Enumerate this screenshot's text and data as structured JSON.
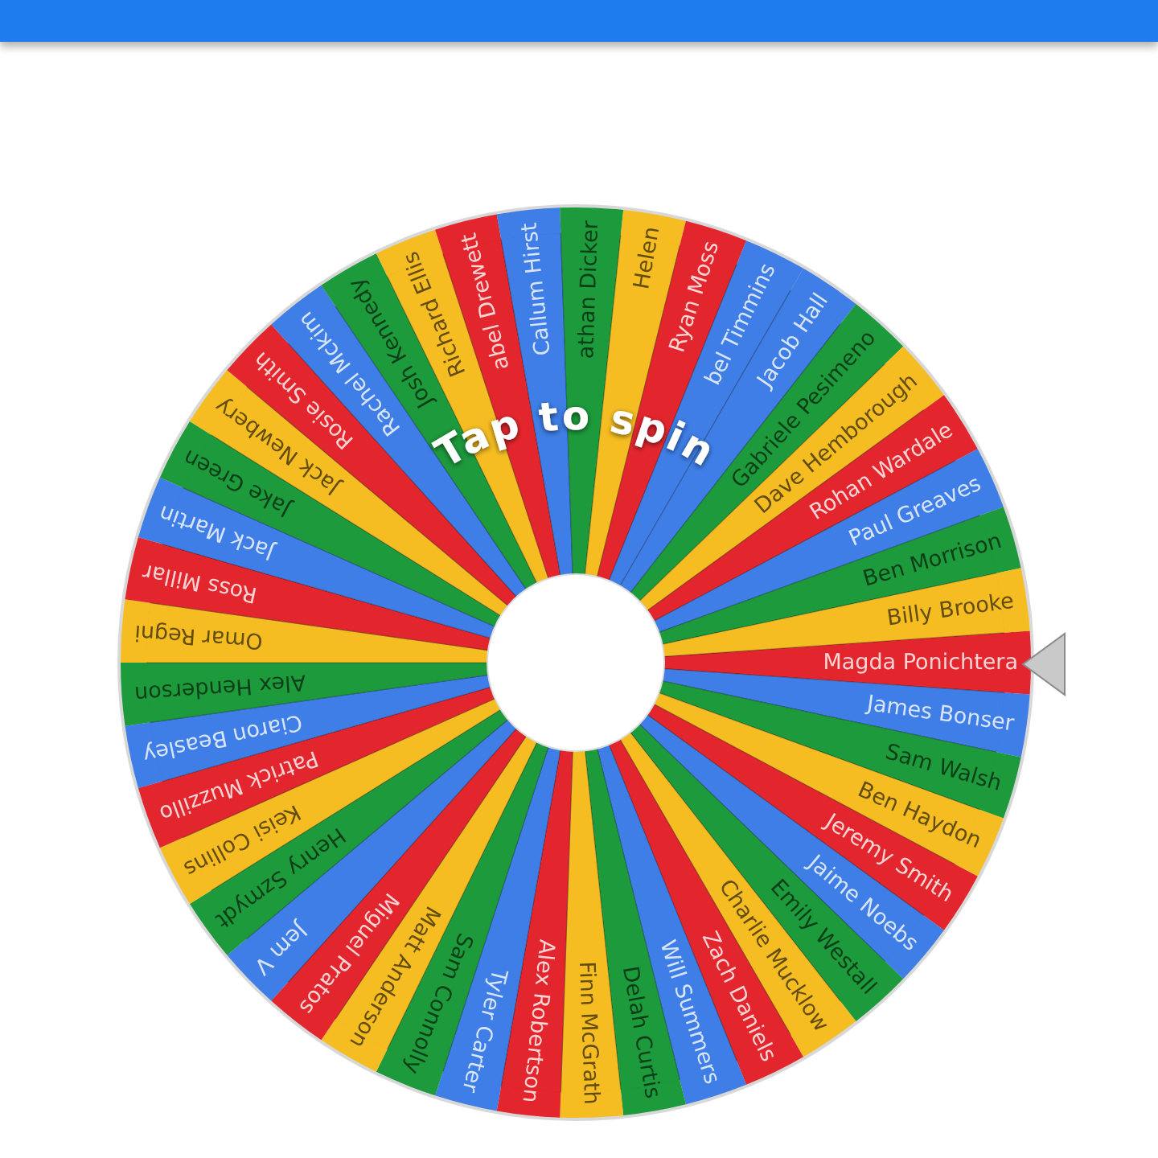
{
  "wheel": {
    "prompt": "Tap to spin",
    "entries": [
      {
        "name": "Magda Ponichtera",
        "color": "#e3262e"
      },
      {
        "name": "James Bonser",
        "color": "#3e7ee6"
      },
      {
        "name": "Sam Walsh",
        "color": "#1d9a3b"
      },
      {
        "name": "Ben Haydon",
        "color": "#f5bd22"
      },
      {
        "name": "Jeremy Smith",
        "color": "#e3262e"
      },
      {
        "name": "Jaime Noebs",
        "color": "#3e7ee6"
      },
      {
        "name": "Emily Westall",
        "color": "#1d9a3b"
      },
      {
        "name": "Charlie Mucklow",
        "color": "#f5bd22"
      },
      {
        "name": "Zach Daniels",
        "color": "#e3262e"
      },
      {
        "name": "Will Summers",
        "color": "#3e7ee6"
      },
      {
        "name": "Delah Curtis",
        "color": "#1d9a3b"
      },
      {
        "name": "Finn McGrath",
        "color": "#f5bd22"
      },
      {
        "name": "Alex Robertson",
        "color": "#e3262e"
      },
      {
        "name": "Tyler Carter",
        "color": "#3e7ee6"
      },
      {
        "name": "Sam Connolly",
        "color": "#1d9a3b"
      },
      {
        "name": "Matt Anderson",
        "color": "#f5bd22"
      },
      {
        "name": "Miguel Pratos",
        "color": "#e3262e"
      },
      {
        "name": "Jem V",
        "color": "#3e7ee6"
      },
      {
        "name": "Henry Szmydt",
        "color": "#1d9a3b"
      },
      {
        "name": "Keisi Collins",
        "color": "#f5bd22"
      },
      {
        "name": "Patrick Muzzillo",
        "color": "#e3262e"
      },
      {
        "name": "Ciaron Beasley",
        "color": "#3e7ee6"
      },
      {
        "name": "Alex Henderson",
        "color": "#1d9a3b"
      },
      {
        "name": "Omar Regni",
        "color": "#f5bd22"
      },
      {
        "name": "Ross Millar",
        "color": "#e3262e"
      },
      {
        "name": "Jack Martin",
        "color": "#3e7ee6"
      },
      {
        "name": "Jake Green",
        "color": "#1d9a3b"
      },
      {
        "name": "Jack Newbery",
        "color": "#f5bd22"
      },
      {
        "name": "Rosie Smith",
        "color": "#e3262e"
      },
      {
        "name": "Rachel Mckim",
        "color": "#3e7ee6"
      },
      {
        "name": "Josh Kennedy",
        "color": "#1d9a3b"
      },
      {
        "name": "Richard Ellis",
        "color": "#f5bd22"
      },
      {
        "name": "abel Drewett",
        "color": "#e3262e"
      },
      {
        "name": "Callum Hirst",
        "color": "#3e7ee6"
      },
      {
        "name": "athan Dicker",
        "color": "#1d9a3b"
      },
      {
        "name": "Helen",
        "color": "#f5bd22"
      },
      {
        "name": "Ryan Moss",
        "color": "#e3262e"
      },
      {
        "name": "bel Timmins",
        "color": "#3e7ee6"
      },
      {
        "name": "Jacob Hall",
        "color": "#3e7ee6"
      },
      {
        "name": "Gabriele Pesimeno",
        "color": "#1d9a3b"
      },
      {
        "name": "Dave Hemborough",
        "color": "#f5bd22"
      },
      {
        "name": "Rohan Wardale",
        "color": "#e3262e"
      },
      {
        "name": "Paul Greaves",
        "color": "#3e7ee6"
      },
      {
        "name": "Ben Morrison",
        "color": "#1d9a3b"
      },
      {
        "name": "Billy Brooke",
        "color": "#f5bd22"
      }
    ]
  }
}
